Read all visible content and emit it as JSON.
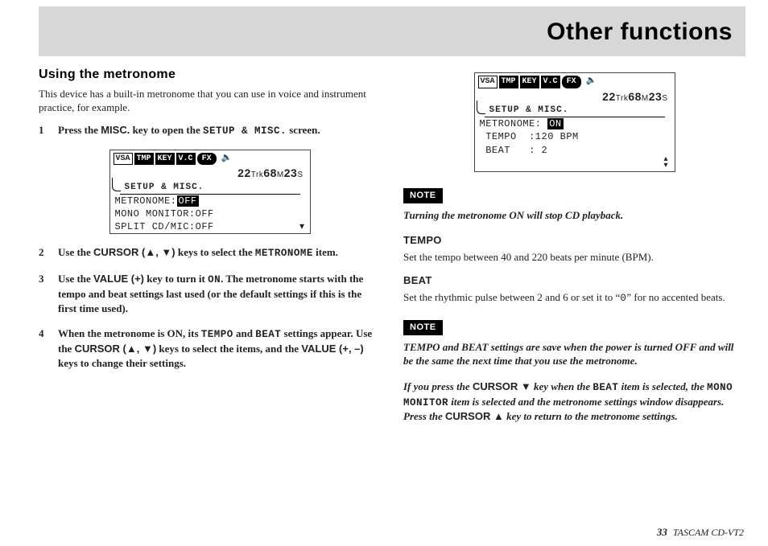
{
  "header": {
    "title": "Other functions"
  },
  "left": {
    "heading": "Using the metronome",
    "intro": "This device has a built-in metronome that you can use in voice and instrument practice, for example.",
    "step1_a": "Press the ",
    "step1_key": "MISC.",
    "step1_b": " key to open the ",
    "step1_screen": "SETUP & MISC.",
    "step1_c": " screen.",
    "step2_a": "Use the ",
    "step2_key": "CURSOR (▲, ▼)",
    "step2_b": " keys to select the ",
    "step2_item": "METRONOME",
    "step2_c": " item.",
    "step3_a": "Use the ",
    "step3_key": "VALUE (+)",
    "step3_b": " key to turn it ",
    "step3_on": "ON",
    "step3_c": ". The metronome starts with the tempo and beat settings last used (or the default settings if this is the first time used).",
    "step4_a": "When the metronome is ON, its ",
    "step4_t": "TEMPO",
    "step4_and": " and ",
    "step4_bt": "BEAT",
    "step4_b": " settings appear. Use the ",
    "step4_key1": "CURSOR (▲, ▼)",
    "step4_c": " keys to select the items, and the ",
    "step4_key2": "VALUE (+, –)",
    "step4_d": " keys to change their settings.",
    "lcd": {
      "tabs": {
        "t1": "VSA",
        "t2": "TMP",
        "t3": "KEY",
        "t4": "V.C",
        "t5": "FX"
      },
      "time_a": "22",
      "time_trk": "Trk",
      "time_b": "68",
      "time_m": "M",
      "time_c": "23",
      "time_s": "S",
      "subhead": "SETUP & MISC.",
      "l1a": "METRONOME:",
      "l1b": "OFF",
      "l2": "MONO MONITOR:OFF",
      "l3": "SPLIT CD/MIC:OFF"
    }
  },
  "right": {
    "lcd": {
      "tabs": {
        "t1": "VSA",
        "t2": "TMP",
        "t3": "KEY",
        "t4": "V.C",
        "t5": "FX"
      },
      "time_a": "22",
      "time_trk": "Trk",
      "time_b": "68",
      "time_m": "M",
      "time_c": "23",
      "time_s": "S",
      "subhead": "SETUP & MISC.",
      "l1a": "METRONOME: ",
      "l1b": "ON",
      "l2": " TEMPO  :120 BPM",
      "l3": " BEAT   : 2"
    },
    "note1_label": "NOTE",
    "note1_text": "Turning the metronome ON will stop CD playback.",
    "tempo_head": "TEMPO",
    "tempo_text": "Set the tempo between 40 and 220 beats per minute (BPM).",
    "beat_head": "BEAT",
    "beat_text_a": "Set the rhythmic pulse between 2 and 6 or set it to “",
    "beat_zero": "0",
    "beat_text_b": "” for no accented beats.",
    "note2_label": "NOTE",
    "note2_text": "TEMPO and BEAT settings are save when the power is turned OFF and will be the same the next time that you use the metronome.",
    "note3_a": "If you press the ",
    "note3_key1": "CURSOR ▼",
    "note3_b": " key when the ",
    "note3_beat": "BEAT",
    "note3_c": " item is selected, the ",
    "note3_mono": "MONO MONITOR",
    "note3_d": " item is selected and the metronome settings window disappears. Press the ",
    "note3_key2": "CURSOR ▲",
    "note3_e": " key to return to the metronome settings."
  },
  "footer": {
    "page": "33",
    "model": "TASCAM  CD-VT2"
  }
}
